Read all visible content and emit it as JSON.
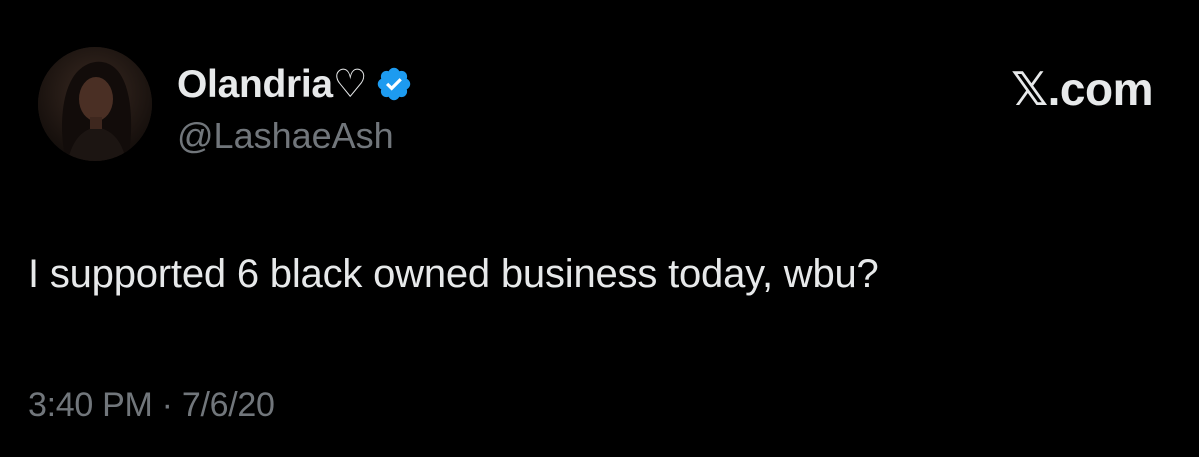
{
  "author": {
    "display_name": "Olandria♡",
    "handle": "@LashaeAsh",
    "verified_icon": "verified-badge-icon",
    "avatar_icon": "profile-photo"
  },
  "brand": {
    "label": "𝕏.com"
  },
  "tweet": {
    "text": "I supported 6 black owned business today, wbu?",
    "timestamp": "3:40 PM · 7/6/20"
  },
  "colors": {
    "background": "#000000",
    "primary_text": "#e7e9ea",
    "secondary_text": "#71767b",
    "verified_blue": "#1d9bf0"
  }
}
